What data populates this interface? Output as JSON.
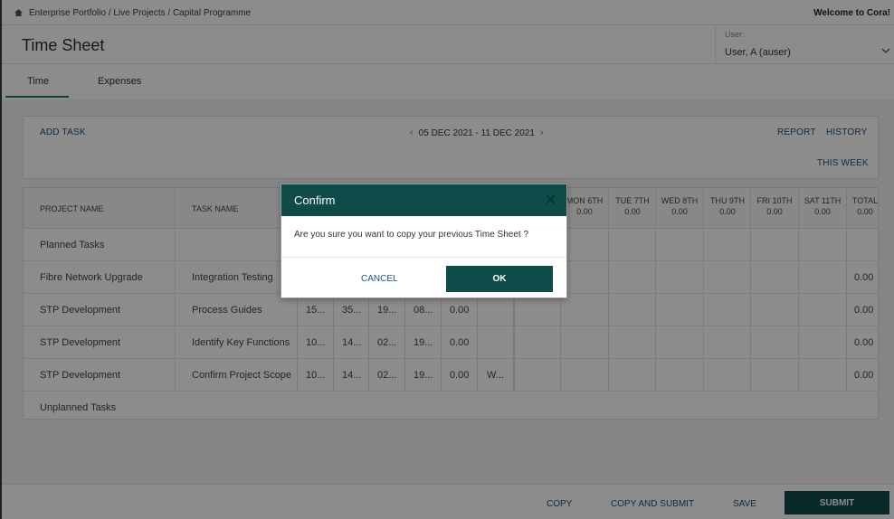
{
  "topbar": {
    "breadcrumb": "Enterprise Portfolio / Live Projects / Capital Programme",
    "welcome": "Welcome to Cora!"
  },
  "header": {
    "title": "Time Sheet",
    "user_label": "User:",
    "user_value": "User, A (auser)"
  },
  "tabs": [
    "Time",
    "Expenses"
  ],
  "toolbar": {
    "add_task": "ADD TASK",
    "date_range": "05 DEC 2021 - 11 DEC 2021",
    "report": "REPORT",
    "history": "HISTORY",
    "this_week": "THIS WEEK"
  },
  "grid": {
    "col_project": "PROJECT NAME",
    "col_task": "TASK NAME",
    "days": [
      {
        "label": "MON 6TH",
        "value": "0.00"
      },
      {
        "label": "TUE 7TH",
        "value": "0.00"
      },
      {
        "label": "WED 8TH",
        "value": "0.00"
      },
      {
        "label": "THU 9TH",
        "value": "0.00"
      },
      {
        "label": "FRI 10TH",
        "value": "0.00"
      },
      {
        "label": "SAT 11TH",
        "value": "0.00"
      },
      {
        "label": "TOTAL",
        "value": "0.00"
      }
    ],
    "planned_label": "Planned Tasks",
    "unplanned_label": "Unplanned Tasks",
    "rows": [
      {
        "project": "Fibre Network Upgrade",
        "task": "Integration Testing",
        "c1": "",
        "c2": "",
        "c3": "",
        "c4": "",
        "c5": "",
        "c6": "",
        "total": "0.00"
      },
      {
        "project": "STP Development",
        "task": "Process Guides",
        "c1": "15...",
        "c2": "35...",
        "c3": "19...",
        "c4": "08...",
        "c5": "0.00",
        "c6": "",
        "total": "0.00"
      },
      {
        "project": "STP Development",
        "task": "Identify Key Functions",
        "c1": "10...",
        "c2": "14...",
        "c3": "02...",
        "c4": "19...",
        "c5": "0.00",
        "c6": "",
        "total": "0.00"
      },
      {
        "project": "STP Development",
        "task": "Confirm Project Scope",
        "c1": "10...",
        "c2": "14...",
        "c3": "02...",
        "c4": "19...",
        "c5": "0.00",
        "c6": "W...",
        "total": "0.00"
      }
    ]
  },
  "bottombar": {
    "copy": "COPY",
    "copy_submit": "COPY AND SUBMIT",
    "save": "SAVE",
    "submit": "SUBMIT"
  },
  "modal": {
    "title": "Confirm",
    "message": "Are you sure you want to copy your previous Time Sheet ?",
    "cancel": "CANCEL",
    "ok": "OK"
  },
  "colors": {
    "accent": "#0f4c49",
    "link": "#1f4e79"
  }
}
